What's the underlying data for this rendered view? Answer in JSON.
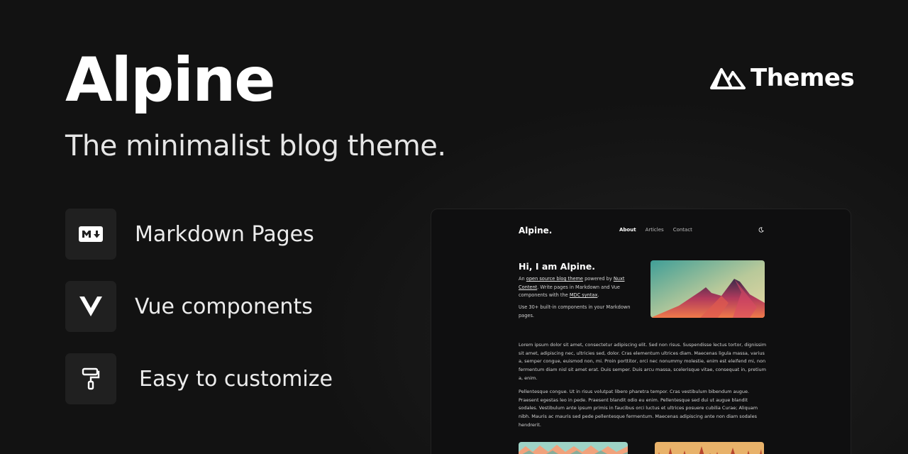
{
  "hero": {
    "title": "Alpine",
    "subtitle": "The minimalist blog theme."
  },
  "brand": {
    "logo_icon": "nuxt-mountain-icon",
    "text": "Themes"
  },
  "features": [
    {
      "icon": "markdown-icon",
      "label": "Markdown Pages"
    },
    {
      "icon": "vue-icon",
      "label": "Vue components"
    },
    {
      "icon": "paint-roller-icon",
      "label": "Easy to customize"
    }
  ],
  "preview": {
    "logo": "Alpine.",
    "nav": [
      "About",
      "Articles",
      "Contact"
    ],
    "theme_toggle_icon": "moon-icon",
    "heading": "Hi, I am Alpine.",
    "intro": {
      "t1": "An ",
      "link1": "open source blog theme",
      "t2": " powered by ",
      "link2": "Nuxt Content",
      "t3": ". Write pages in Markdown and Vue components with the ",
      "link3": "MDC syntax",
      "t4": "."
    },
    "intro2": "Use 30+ built-in components in your Markdown pages.",
    "paragraph1": "Lorem ipsum dolor sit amet, consectetur adipiscing elit. Sed non risus. Suspendisse lectus tortor, dignissim sit amet, adipiscing nec, ultricies sed, dolor. Cras elementum ultrices diam. Maecenas ligula massa, varius a, semper congue, euismod non, mi. Proin porttitor, orci nec nonummy molestie, enim est eleifend mi, non fermentum diam nisl sit amet erat. Duis semper. Duis arcu massa, scelerisque vitae, consequat in, pretium a, enim.",
    "paragraph2": "Pellentesque congue. Ut in risus volutpat libero pharetra tempor. Cras vestibulum bibendum augue. Praesent egestas leo in pede. Praesent blandit odio eu enim. Pellentesque sed dui ut augue blandit sodales. Vestibulum ante ipsum primis in faucibus orci luctus et ultrices posuere cubilia Curae; Aliquam nibh. Mauris ac mauris sed pede pellentesque fermentum. Maecenas adipiscing ante non diam sodales hendrerit."
  },
  "colors": {
    "background": "#131313",
    "card": "#202020",
    "preview_bg": "#0f0f10",
    "text": "#ffffff"
  }
}
